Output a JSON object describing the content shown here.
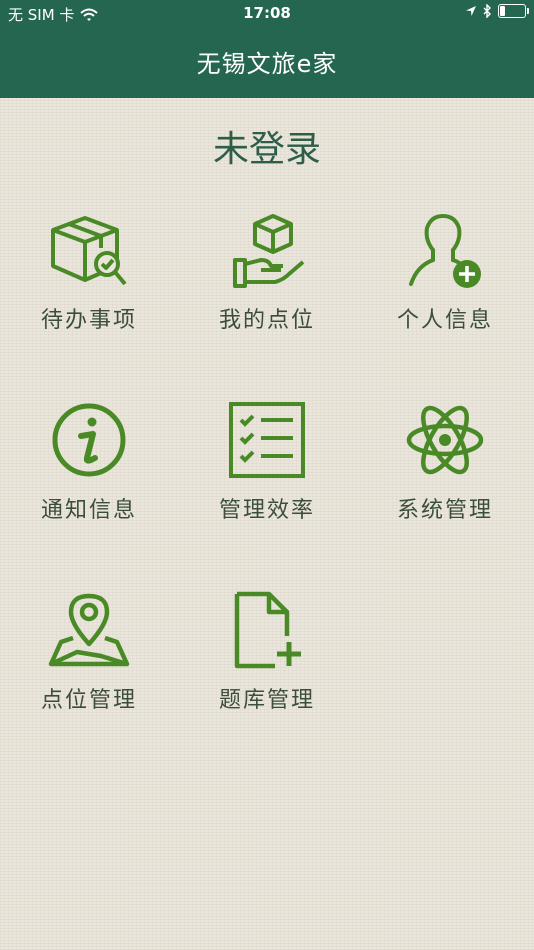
{
  "status_bar": {
    "carrier": "无 SIM 卡",
    "time": "17:08"
  },
  "header": {
    "title": "无锡文旅e家"
  },
  "page": {
    "title": "未登录"
  },
  "menu": [
    {
      "label": "待办事项",
      "icon": "box-search-icon"
    },
    {
      "label": "我的点位",
      "icon": "hand-box-icon"
    },
    {
      "label": "个人信息",
      "icon": "user-add-icon"
    },
    {
      "label": "通知信息",
      "icon": "info-icon"
    },
    {
      "label": "管理效率",
      "icon": "checklist-icon"
    },
    {
      "label": "系统管理",
      "icon": "atom-icon"
    },
    {
      "label": "点位管理",
      "icon": "map-pin-icon"
    },
    {
      "label": "题库管理",
      "icon": "document-add-icon"
    }
  ],
  "colors": {
    "header_bg": "#256651",
    "icon_green": "#4a8a26",
    "title_green": "#2d5e4a",
    "background": "#ebe6dc"
  }
}
